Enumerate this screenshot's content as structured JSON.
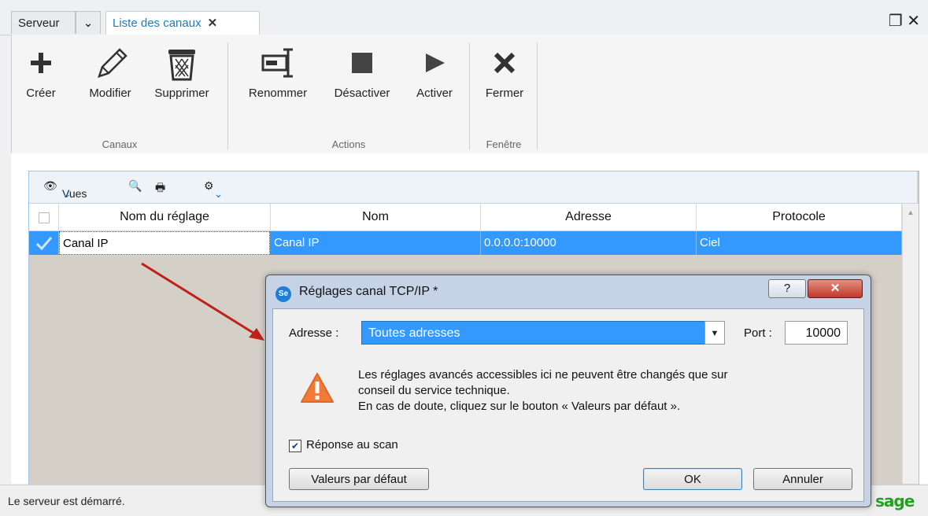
{
  "tabs": {
    "serveur": "Serveur",
    "liste": "Liste des canaux"
  },
  "ribbon": {
    "groups": {
      "canaux": "Canaux",
      "actions": "Actions",
      "fenetre": "Fenêtre"
    },
    "buttons": {
      "creer": "Créer",
      "modifier": "Modifier",
      "supprimer": "Supprimer",
      "renommer": "Renommer",
      "desactiver": "Désactiver",
      "activer": "Activer",
      "fermer": "Fermer"
    }
  },
  "grid": {
    "toolbar": {
      "vues": "Vues"
    },
    "columns": [
      "Nom du réglage",
      "Nom",
      "Adresse",
      "Protocole"
    ],
    "rows": [
      {
        "nom_reglage": "Canal IP",
        "nom": "Canal IP",
        "adresse": "0.0.0.0:10000",
        "protocole": "Ciel"
      }
    ]
  },
  "status": {
    "text": "Le serveur est démarré.",
    "brand": "sage"
  },
  "dialog": {
    "logo": "Se",
    "title": "Réglages canal TCP/IP *",
    "adresse_label": "Adresse :",
    "adresse_value": "Toutes adresses",
    "port_label": "Port :",
    "port_value": "10000",
    "warning_lines": [
      "Les réglages avancés accessibles ici ne peuvent être changés que sur",
      "conseil du service technique.",
      "En cas de doute, cliquez sur le bouton « Valeurs par défaut »."
    ],
    "checkbox_label": "Réponse au scan",
    "checkbox_checked": true,
    "btn_defaut": "Valeurs par défaut",
    "btn_ok": "OK",
    "btn_annuler": "Annuler"
  },
  "colors": {
    "accent": "#3399ff",
    "tab_active": "#1a7cc4",
    "warning": "#f07a36",
    "arrow": "#c0201a"
  }
}
